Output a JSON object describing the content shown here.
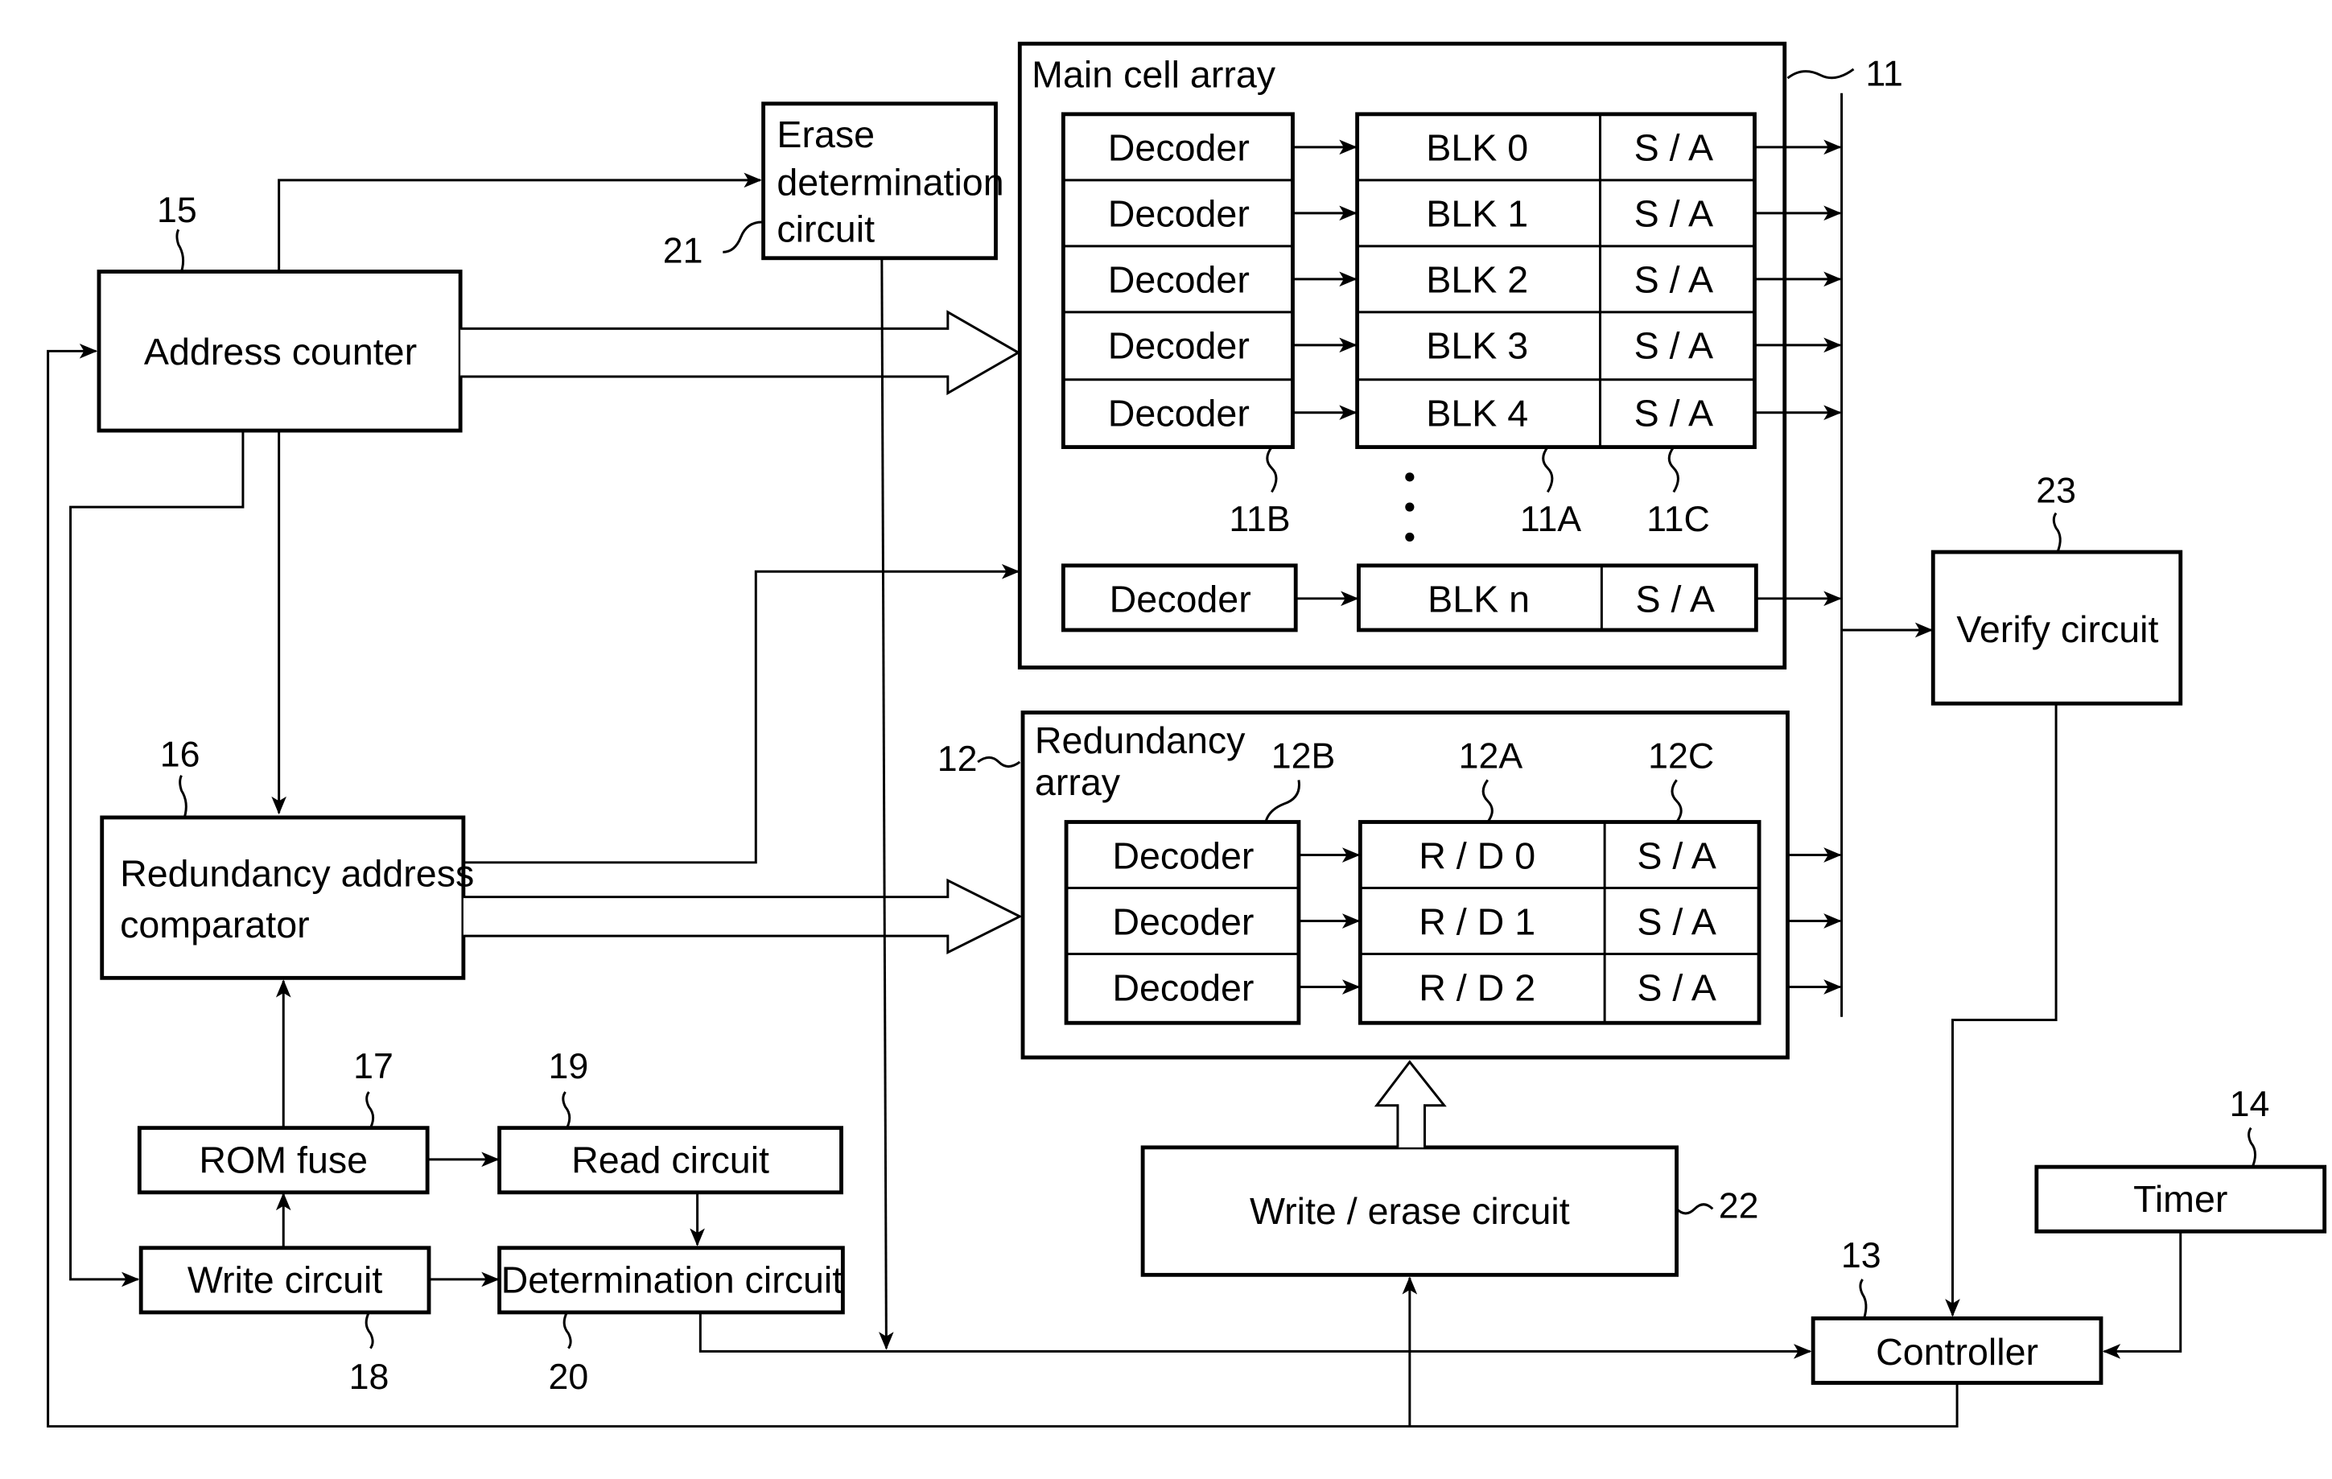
{
  "diagram": {
    "main_array": {
      "title": "Main cell array",
      "ref": "11",
      "decoder_ref": "11B",
      "block_ref": "11A",
      "sa_ref": "11C",
      "decoder_label": "Decoder",
      "sa_label": "S / A",
      "ellipsis": ":",
      "blocks": [
        "BLK 0",
        "BLK 1",
        "BLK 2",
        "BLK 3",
        "BLK 4",
        "BLK n"
      ]
    },
    "redundancy_array": {
      "title_line1": "Redundancy",
      "title_line2": "array",
      "ref": "12",
      "decoder_ref": "12B",
      "block_ref": "12A",
      "sa_ref": "12C",
      "decoder_label": "Decoder",
      "sa_label": "S / A",
      "blocks": [
        "R / D 0",
        "R / D 1",
        "R / D 2"
      ]
    },
    "erase_determination": {
      "line1": "Erase",
      "line2": "determination",
      "line3": "circuit",
      "ref": "21"
    },
    "address_counter": {
      "label": "Address  counter",
      "ref": "15"
    },
    "redundancy_comparator": {
      "line1": "Redundancy  address",
      "line2": "comparator",
      "ref": "16"
    },
    "rom_fuse": {
      "label": "ROM  fuse",
      "ref": "17"
    },
    "write_circuit": {
      "label": "Write  circuit",
      "ref": "18"
    },
    "read_circuit": {
      "label": "Read  circuit",
      "ref": "19"
    },
    "determination_circuit": {
      "label": "Determination  circuit",
      "ref": "20"
    },
    "write_erase_circuit": {
      "label": "Write / erase  circuit",
      "ref": "22"
    },
    "verify_circuit": {
      "label": "Verify  circuit",
      "ref": "23"
    },
    "controller": {
      "label": "Controller",
      "ref": "13"
    },
    "timer": {
      "label": "Timer",
      "ref": "14"
    }
  }
}
